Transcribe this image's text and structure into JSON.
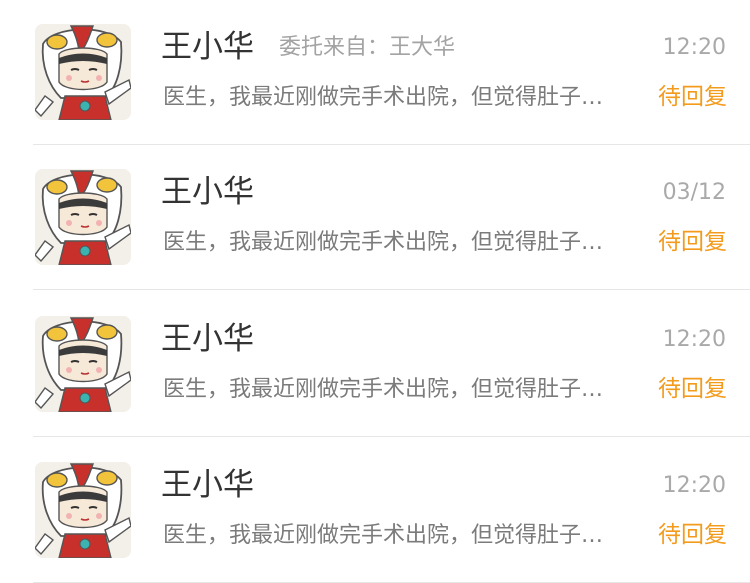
{
  "messages": [
    {
      "name": "王小华",
      "delegate": "委托来自：王大华",
      "time": "12:20",
      "preview": "医生，我最近刚做完手术出院，但觉得肚子还是不舒服",
      "status": "待回复"
    },
    {
      "name": "王小华",
      "delegate": "",
      "time": "03/12",
      "preview": "医生，我最近刚做完手术出院，但觉得肚子还是不舒服",
      "status": "待回复"
    },
    {
      "name": "王小华",
      "delegate": "",
      "time": "12:20",
      "preview": "医生，我最近刚做完手术出院，但觉得肚子还是不舒服",
      "status": "待回复"
    },
    {
      "name": "王小华",
      "delegate": "",
      "time": "12:20",
      "preview": "医生，我最近刚做完手术出院，但觉得肚子还是不舒服",
      "status": "待回复"
    }
  ],
  "colors": {
    "status": "#f39b1d",
    "name": "#333333",
    "preview": "#7b7b7b",
    "meta": "#a9a9a9"
  },
  "icons": {
    "avatar": "cartoon-hero-avatar"
  }
}
